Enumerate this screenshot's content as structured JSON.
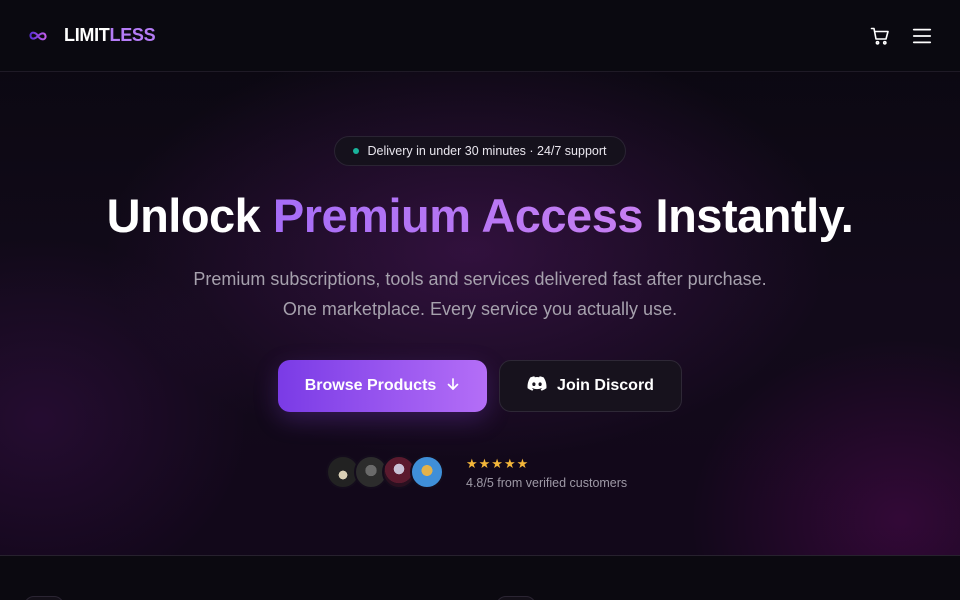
{
  "brand": {
    "name_part1": "LIMIT",
    "name_part2": "LESS",
    "logo_icon": "infinity-icon",
    "accent_color": "#b57cf6"
  },
  "nav": {
    "cart_icon": "cart-icon",
    "menu_icon": "hamburger-menu-icon"
  },
  "hero": {
    "badge_text": "Delivery in under 30 minutes · 24/7 support",
    "badge_dot_color": "#19b39b",
    "headline_part1": "Unlock ",
    "headline_highlight": "Premium Access",
    "headline_part2": " Instantly.",
    "subheading": "Premium subscriptions, tools and services delivered fast after purchase. One marketplace. Every service you actually use.",
    "primary_button_label": "Browse Products",
    "primary_button_icon": "arrow-down-icon",
    "secondary_button_label": "Join Discord",
    "secondary_button_icon": "discord-icon",
    "stars": "★★★★★",
    "star_color": "#f4b63a",
    "rating_text": "4.8/5 from verified customers"
  }
}
